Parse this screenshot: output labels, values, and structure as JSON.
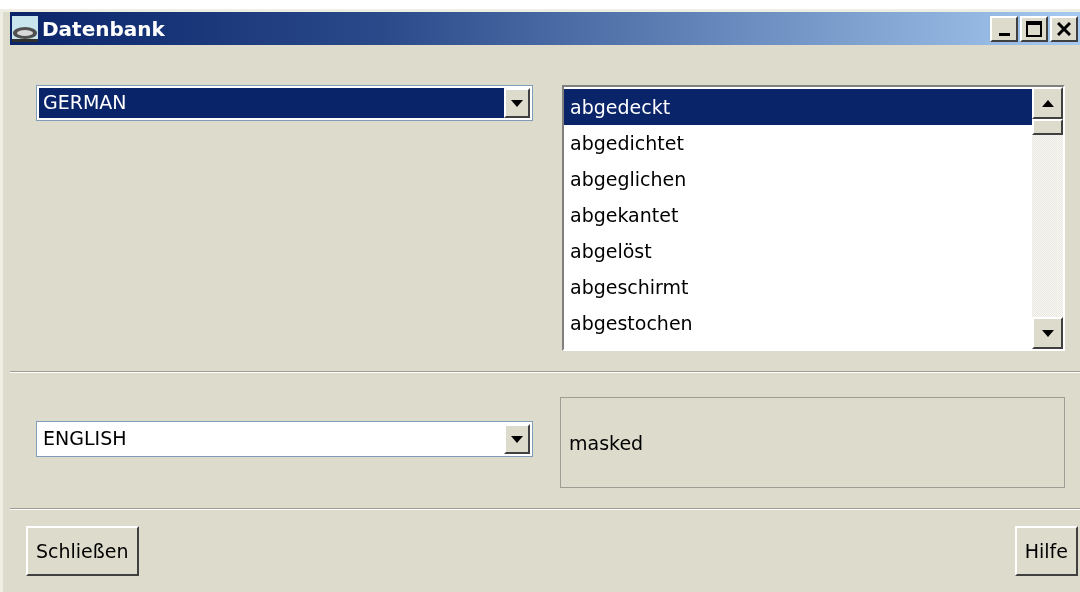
{
  "window": {
    "title": "Datenbank",
    "controls": [
      {
        "kind": "minimize"
      },
      {
        "kind": "maximize"
      },
      {
        "kind": "close"
      }
    ]
  },
  "source": {
    "language": {
      "value": "GERMAN",
      "focused": true
    },
    "terms": [
      {
        "label": "abgedeckt",
        "selected": true
      },
      {
        "label": "abgedichtet",
        "selected": false
      },
      {
        "label": "abgeglichen",
        "selected": false
      },
      {
        "label": "abgekantet",
        "selected": false
      },
      {
        "label": "abgelöst",
        "selected": false
      },
      {
        "label": "abgeschirmt",
        "selected": false
      },
      {
        "label": "abgestochen",
        "selected": false
      }
    ]
  },
  "target": {
    "language": {
      "value": "ENGLISH",
      "focused": false
    },
    "translation": "masked"
  },
  "buttons": [
    {
      "label": "Schließen"
    },
    {
      "label": "Hilfe"
    }
  ]
}
